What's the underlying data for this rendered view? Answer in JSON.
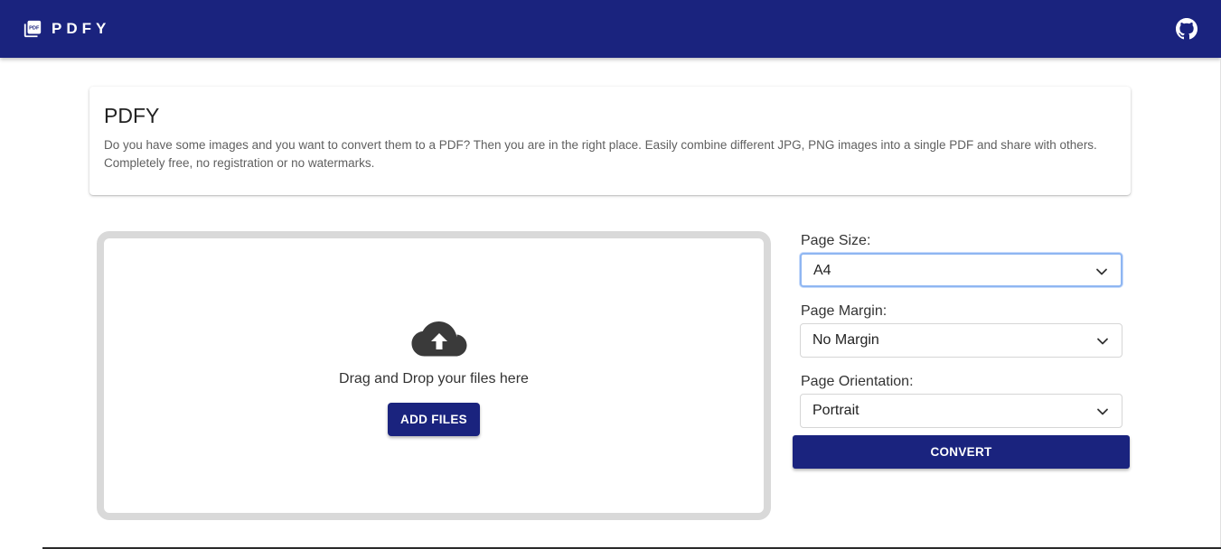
{
  "header": {
    "brand": "PDFY",
    "logo_icon": "pdf-file-icon",
    "github_icon": "github-icon",
    "background_color": "#1a237e"
  },
  "intro": {
    "title": "PDFY",
    "description": "Do you have some images and you want to convert them to a PDF? Then you are in the right place. Easily combine different JPG, PNG images into a single PDF and share with others. Completely free, no registration or no watermarks."
  },
  "dropzone": {
    "icon": "cloud-upload-icon",
    "text": "Drag and Drop your files here",
    "add_files_label": "ADD FILES"
  },
  "settings": {
    "page_size": {
      "label": "Page Size:",
      "value": "A4"
    },
    "page_margin": {
      "label": "Page Margin:",
      "value": "No Margin"
    },
    "page_orientation": {
      "label": "Page Orientation:",
      "value": "Portrait"
    },
    "convert_label": "CONVERT"
  },
  "colors": {
    "primary": "#1a237e",
    "focus_ring": "#8fb6f2",
    "dropzone_border": "#d9d9d9"
  }
}
